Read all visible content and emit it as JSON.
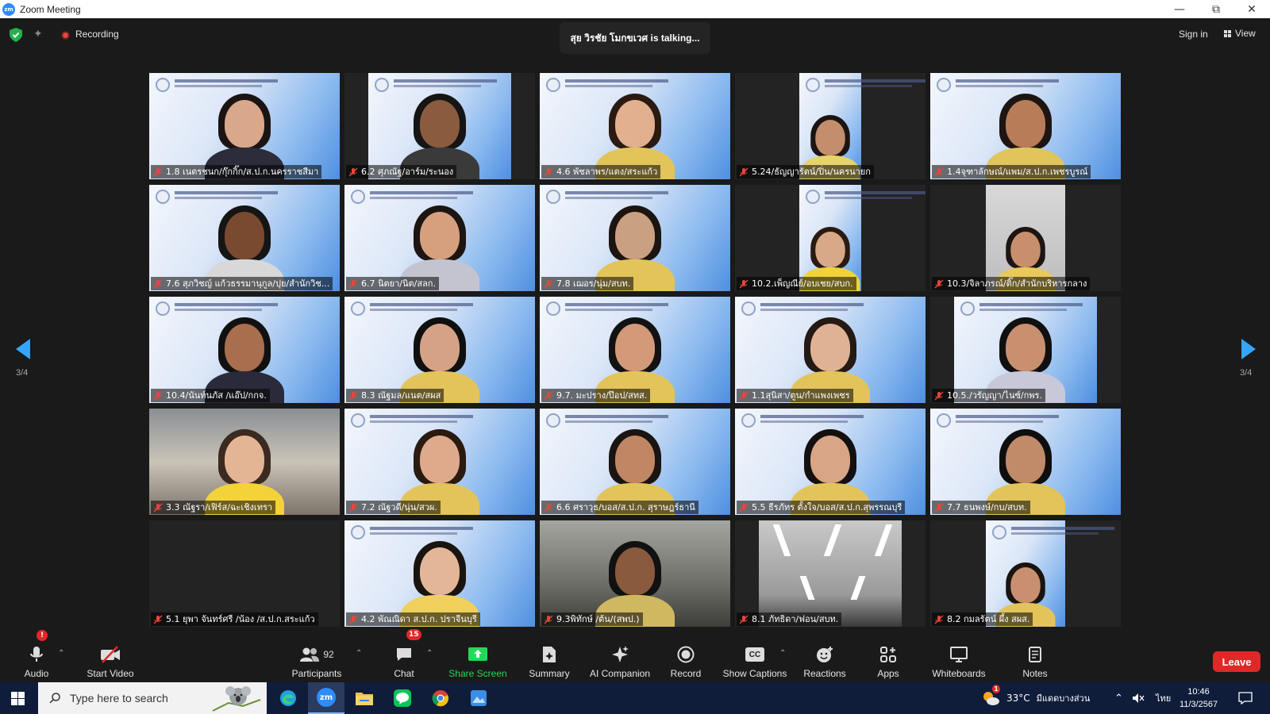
{
  "window": {
    "title": "Zoom Meeting",
    "app_icon": "zm"
  },
  "topbar": {
    "recording_label": "Recording",
    "talking_text": "สุย วิรชัย โมกขเวศ is  talking...",
    "sign_in": "Sign in",
    "view": "View"
  },
  "gallery": {
    "page_left": "3/4",
    "page_right": "3/4",
    "tiles": [
      {
        "name": "1.8 เนตรชนก/กุ๊กกิ๊ก/ส.ป.ก.นครราชสีมา"
      },
      {
        "name": "6.2 ศุภณัฐ/อาร์ม/ระนอง"
      },
      {
        "name": "4.6 พัชลาพร/แตง/สระแก้ว"
      },
      {
        "name": "5.24/ธัญญารัตน์/ปิ่น/นครนายก"
      },
      {
        "name": "1.4จุฑาลักษณ์/แพม/ส.ป.ก.เพชรบูรณ์"
      },
      {
        "name": "7.6 สุภวิชญ์ แก้วธรรมานุกูล/ปุย/สำนักวิช..."
      },
      {
        "name": "6.7 นิตยา/นิต/สลก."
      },
      {
        "name": "7.8 เฌอร/นุ่ม/สบท."
      },
      {
        "name": "10.2.เพ็ญณีย์/อบเชย/สบก."
      },
      {
        "name": "10.3/จิลาภรณ์/ติ๊ก/สำนักบริหารกลาง"
      },
      {
        "name": "10.4/นันท์นภัส /แอ๊ป/กกจ."
      },
      {
        "name": "8.3 ณัฐมล/แนต/สผส"
      },
      {
        "name": "9.7. มะปราง/ป๊อป/สทส."
      },
      {
        "name": "1.1สุนิสา/ตูน/กำแพงเพชร"
      },
      {
        "name": "10.5./วรัญญา/ไนซ์/กพร."
      },
      {
        "name": "3.3 ณัฐรา/เฟิร์ส/ฉะเชิงเทรา"
      },
      {
        "name": "7.2 ณัฐวดี/นุ่น/สวผ."
      },
      {
        "name": "6.6 ศราวุธ/บอส/ส.ป.ก. สุราษฎร์ธานี"
      },
      {
        "name": "5.5 ธีรภัทร ตั้งใจ/บอส/ส.ป.ก.สุพรรณบุรี"
      },
      {
        "name": "7.7 ธนพงษ์/กบ/สบท."
      },
      {
        "name": "5.1 ยุพา จันทร์ศรี /น้อง /ส.ป.ก.สระแก้ว"
      },
      {
        "name": "4.2 พัณณิดา ส.ป.ก. ปราจีนบุรี"
      },
      {
        "name": "9.3พิทักษ์ /ต้น/(สพป.)"
      },
      {
        "name": "8.1 ภัทธิดา/ฟอน/สบท."
      },
      {
        "name": "8.2 กมลรัตน์ ผึ้ง สผส."
      }
    ]
  },
  "toolbar": {
    "audio": "Audio",
    "audio_badge": "!",
    "start_video": "Start Video",
    "participants": "Participants",
    "participants_count": "92",
    "chat": "Chat",
    "chat_badge": "15",
    "share_screen": "Share Screen",
    "summary": "Summary",
    "ai_companion": "AI Companion",
    "record": "Record",
    "show_captions": "Show Captions",
    "reactions": "Reactions",
    "apps": "Apps",
    "whiteboards": "Whiteboards",
    "notes": "Notes",
    "leave": "Leave",
    "captions_icon_text": "CC"
  },
  "taskbar": {
    "search_placeholder": "Type here to search",
    "weather": "33°C",
    "weather_desc": "มีแดดบางส่วน",
    "lang": "ไทย",
    "time": "10:46",
    "date": "11/3/2567",
    "weather_badge": "1",
    "zoom_label": "zm"
  },
  "colors": {
    "accent": "#2d8cff",
    "leave": "#e02828",
    "share": "#23d959",
    "arrow": "#35a5ff"
  }
}
